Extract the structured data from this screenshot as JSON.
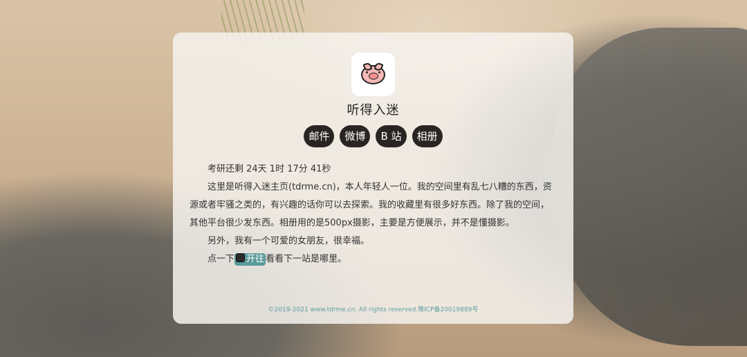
{
  "site": {
    "name": "听得入迷"
  },
  "nav": [
    {
      "label": "邮件"
    },
    {
      "label": "微博"
    },
    {
      "label": "B 站"
    },
    {
      "label": "相册"
    }
  ],
  "content": {
    "countdown": "考研还剩 24天 1时 17分 41秒",
    "intro": "这里是听得入迷主页(tdrme.cn)，本人年轻人一位。我的空间里有乱七八糟的东西，资源或者牢骚之类的，有兴趣的话你可以去探索。我的收藏里有很多好东西。除了我的空间，其他平台很少发东西。相册用的是500px摄影，主要是方便展示，并不是懂摄影。",
    "girlfriend": "另外，我有一个可爱的女朋友，很幸福。",
    "travel_prefix": "点一下",
    "travel_button": "开往",
    "travel_suffix": "看看下一站是哪里。"
  },
  "footer": {
    "text": "©2019-2021 www.tdrme.cn. All rights reserved.豫ICP备20019889号"
  },
  "icons": {
    "avatar": "pig-icon",
    "travel": "train-icon"
  },
  "colors": {
    "pill_bg": "#2a2523",
    "travel_bg": "#5a9a9a",
    "footer_text": "#5f9e9e"
  }
}
